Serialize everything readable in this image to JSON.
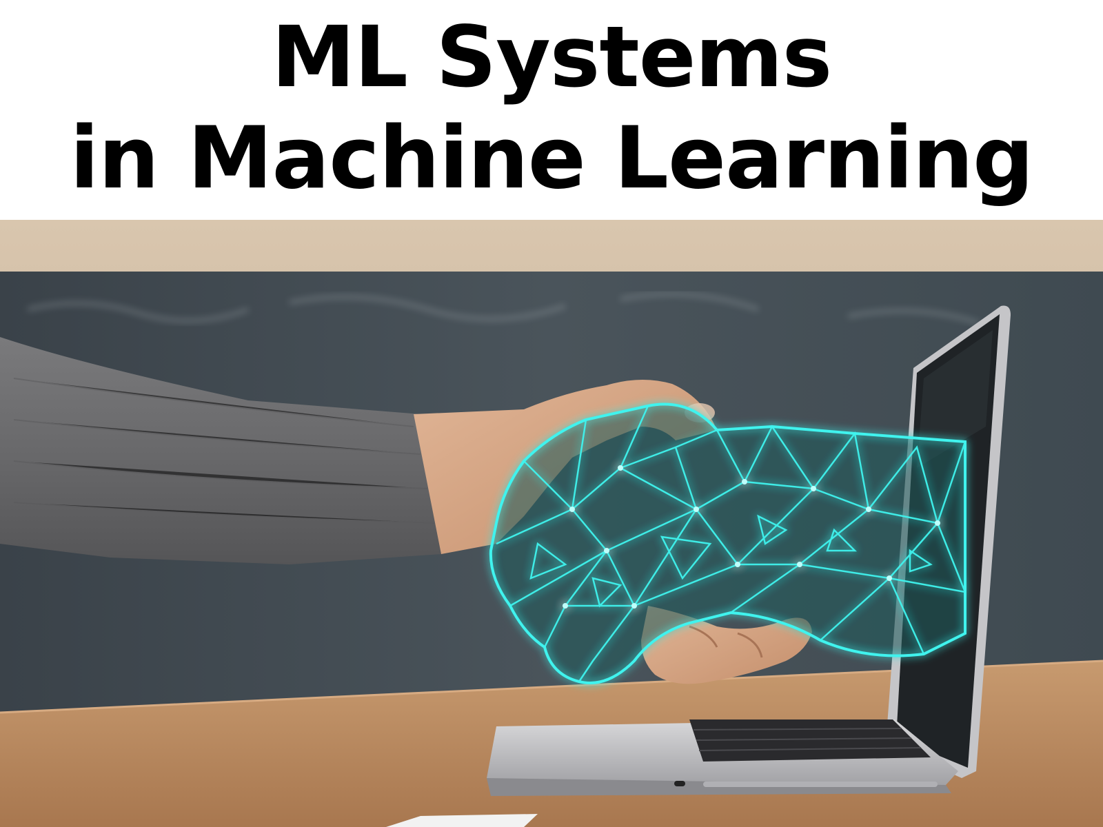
{
  "title": {
    "line1": "ML Systems",
    "line2": "in Machine Learning"
  },
  "image": {
    "subject": "handshake-human-and-wireframe-hand-from-laptop"
  },
  "colors": {
    "title_text": "#000000",
    "background": "#ffffff",
    "wireframe_glow": "#3ff3ee",
    "sweater": "#6b6b6d",
    "desk": "#b8865e",
    "chalkboard": "#3e4850"
  }
}
